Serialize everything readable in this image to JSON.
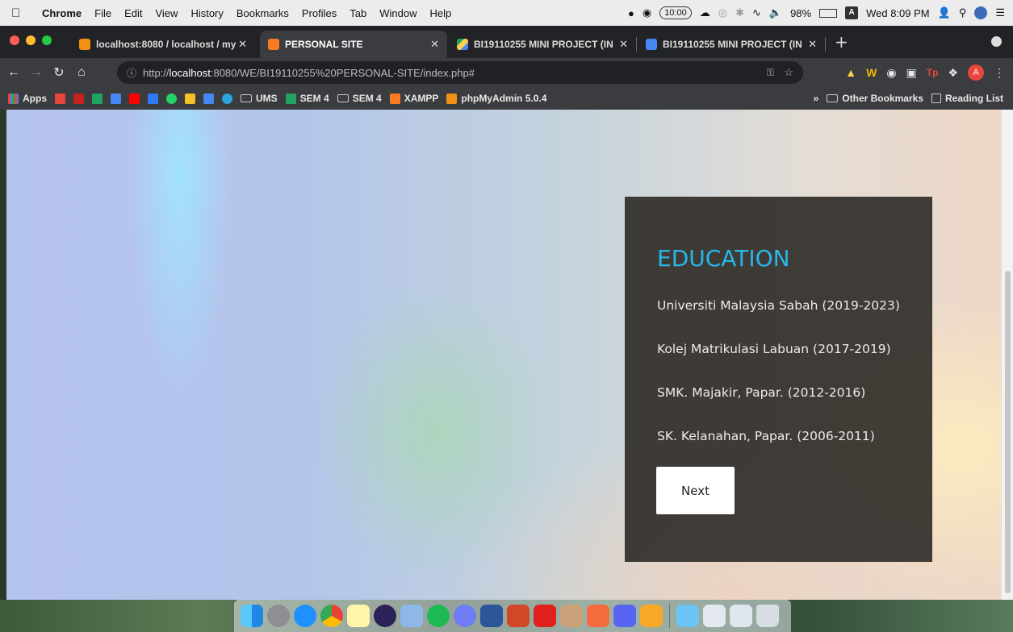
{
  "menubar": {
    "app": "Chrome",
    "items": [
      "File",
      "Edit",
      "View",
      "History",
      "Bookmarks",
      "Profiles",
      "Tab",
      "Window",
      "Help"
    ],
    "clock_pill": "10:00",
    "battery": "98%",
    "input_badge": "A",
    "datetime": "Wed 8:09 PM"
  },
  "tabs": [
    {
      "label": "localhost:8080 / localhost / my",
      "icon": "phpmyadmin-icon",
      "active": false
    },
    {
      "label": "PERSONAL SITE",
      "icon": "xampp-icon",
      "active": true
    },
    {
      "label": "BI19110255 MINI PROJECT (IN",
      "icon": "drive-icon",
      "active": false
    },
    {
      "label": "BI19110255 MINI PROJECT (IN",
      "icon": "docs-icon",
      "active": false
    }
  ],
  "address": {
    "prefix": "http://",
    "host": "localhost",
    "rest": ":8080/WE/BI19110255%20PERSONAL-SITE/index.php#"
  },
  "profile_initial": "A",
  "bookmarks": {
    "apps": "Apps",
    "ums": "UMS",
    "sem4_drive": "SEM 4",
    "sem4_folder": "SEM 4",
    "xampp": "XAMPP",
    "phpmyadmin": "phpMyAdmin 5.0.4",
    "overflow": "»",
    "other": "Other Bookmarks",
    "reading": "Reading List"
  },
  "page": {
    "heading": "EDUCATION",
    "education": [
      "Universiti Malaysia Sabah (2019-2023)",
      "Kolej Matrikulasi Labuan (2017-2019)",
      "SMK. Majakir, Papar. (2012-2016)",
      "SK. Kelanahan, Papar. (2006-2011)"
    ],
    "next_label": "Next"
  },
  "colors": {
    "accent": "#27b7e9",
    "panel": "#34312d",
    "chrome_dark": "#222326",
    "chrome_toolbar": "#3b3c3f"
  }
}
